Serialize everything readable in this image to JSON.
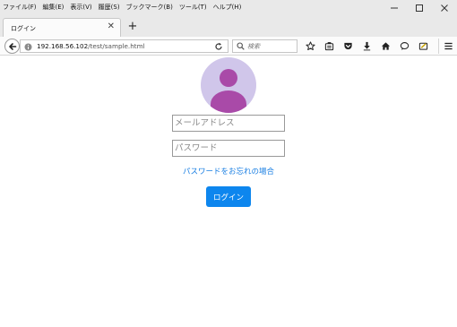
{
  "menubar": {
    "items": [
      "ファイル(F)",
      "編集(E)",
      "表示(V)",
      "履歴(S)",
      "ブックマーク(B)",
      "ツール(T)",
      "ヘルプ(H)"
    ]
  },
  "window_controls": {
    "minimize": "–",
    "maximize": "□",
    "close": "✕"
  },
  "tab": {
    "title": "ログイン",
    "close": "✕"
  },
  "newtab": {
    "label": "+"
  },
  "urlbar": {
    "host": "192.168.56.102",
    "path": "/test/sample.html",
    "reload": "↻"
  },
  "searchbar": {
    "placeholder": "検索"
  },
  "toolbar_icons": [
    "star-icon",
    "reader-view-icon",
    "pocket-icon",
    "download-icon",
    "home-icon",
    "chat-icon",
    "screenshot-icon",
    "hamburger-menu-icon"
  ],
  "login": {
    "email_placeholder": "メールアドレス",
    "password_placeholder": "パスワード",
    "forgot_text": "パスワードをお忘れの場合",
    "button_label": "ログイン"
  },
  "colors": {
    "avatar_bg": "#d0c6ea",
    "avatar_figure": "#a94aa8",
    "link": "#1a7fe3",
    "button": "#0d86ee"
  }
}
